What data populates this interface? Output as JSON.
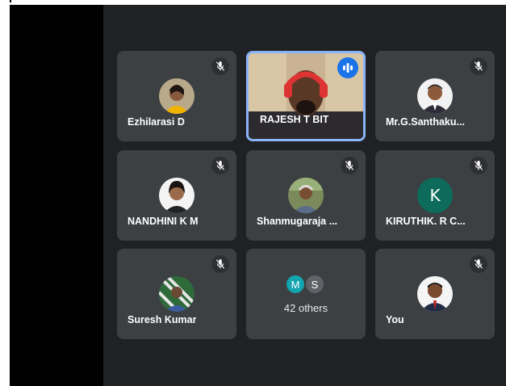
{
  "colors": {
    "tile_bg": "#3c4043",
    "meeting_bg": "#202124",
    "speaking_blue": "#1a73e8",
    "active_border": "#8ab4f8"
  },
  "participants": [
    {
      "name": "Ezhilarasi D",
      "muted": true
    },
    {
      "name": "RAJESH T BIT",
      "speaking": true,
      "video": true
    },
    {
      "name": "Mr.G.Santhaku...",
      "muted": true
    },
    {
      "name": "NANDHINI K M",
      "muted": true
    },
    {
      "name": "Shanmugaraja ...",
      "muted": true
    },
    {
      "name": "KIRUTHIK. R C...",
      "muted": true,
      "avatar_letter": "K",
      "avatar_color": "#0d6b5b"
    },
    {
      "name": "Suresh Kumar",
      "muted": true
    },
    {
      "name": "You",
      "muted": true
    }
  ],
  "others": {
    "count_label": "42 others",
    "avatars": [
      {
        "letter": "M",
        "color": "#12a4af"
      },
      {
        "letter": "S",
        "color": "#5f6368"
      }
    ]
  },
  "icons": {
    "mute": "mic-off-icon",
    "speaking": "audio-level-icon"
  }
}
